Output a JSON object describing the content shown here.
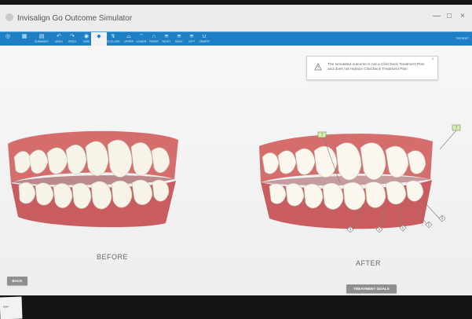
{
  "window": {
    "title": "Invisalign Go Outcome Simulator",
    "controls": [
      "—",
      "□",
      "×"
    ]
  },
  "toolbar": {
    "right_label": "PATIENT",
    "items": [
      {
        "label": "",
        "icon": "◎"
      },
      {
        "label": "",
        "icon": "▦"
      },
      {
        "label": "SUMMARY",
        "icon": "▤"
      },
      {
        "label": "UNDO",
        "icon": "↶"
      },
      {
        "label": "REDO",
        "icon": "↷"
      },
      {
        "label": "SIZE",
        "icon": "◉"
      },
      {
        "label": "",
        "icon": "◆"
      },
      {
        "label": "OCCLUDE",
        "icon": "↯"
      },
      {
        "label": "UPPER",
        "icon": "⌓"
      },
      {
        "label": "LOWER",
        "icon": "⌔"
      },
      {
        "label": "FRONT",
        "icon": "∩"
      },
      {
        "label": "RIGHT",
        "icon": "≋"
      },
      {
        "label": "BACK",
        "icon": "≋"
      },
      {
        "label": "LEFT",
        "icon": "≋"
      },
      {
        "label": "SEMITR",
        "icon": "∪"
      }
    ]
  },
  "notice": {
    "text": "The simulated outcome is not a ClinCheck Treatment Plan and does not replace ClinCheck Treatment Plan",
    "close": "×"
  },
  "views": {
    "before_label": "BEFORE",
    "after_label": "AFTER"
  },
  "markers": [
    "7",
    "7",
    "5",
    "5",
    "5",
    "5",
    "5"
  ],
  "buttons": {
    "back": "BACK",
    "treatment_goals": "TREATMENT GOALS"
  },
  "sticky_note": {
    "text": "iCam"
  },
  "colors": {
    "toolbar": "#1e7fc4",
    "gum": "#d46d6c",
    "tooth": "#f8f3e9",
    "button": "#8f8f8f"
  }
}
